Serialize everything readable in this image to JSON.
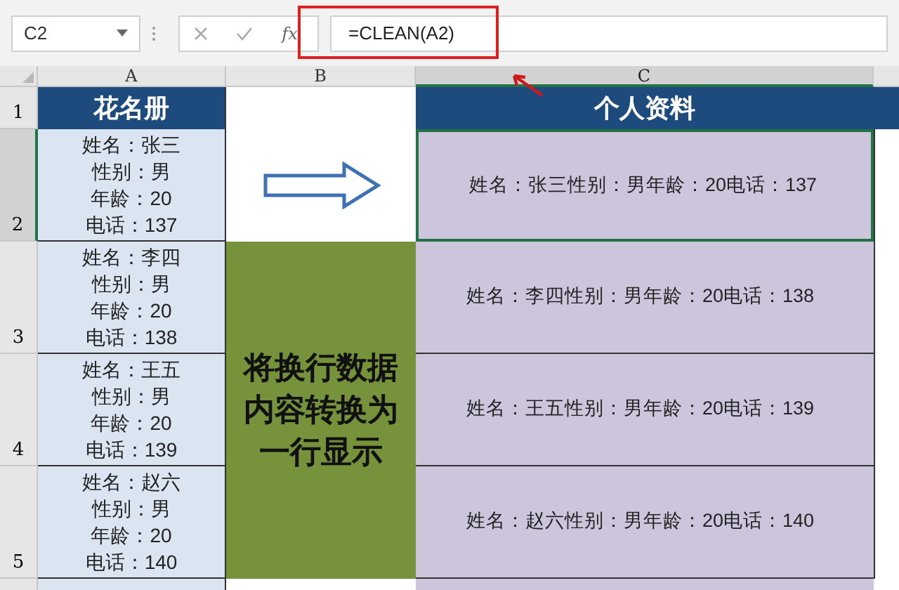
{
  "name_box": "C2",
  "function_label": "fx",
  "formula": "=CLEAN(A2)",
  "columns": [
    {
      "label": "A",
      "selected": false
    },
    {
      "label": "B",
      "selected": false
    },
    {
      "label": "C",
      "selected": true
    }
  ],
  "rows": [
    {
      "number": "1",
      "selected": false
    },
    {
      "number": "2",
      "selected": true
    },
    {
      "number": "3",
      "selected": false
    },
    {
      "number": "4",
      "selected": false
    },
    {
      "number": "5",
      "selected": false
    }
  ],
  "headers": {
    "source": "花名册",
    "result": "个人资料"
  },
  "note": [
    "将换行数据",
    "内容转换为",
    "一行显示"
  ],
  "records": [
    {
      "source": [
        "姓名：张三",
        "性别：男",
        "年龄：20",
        "电话：137"
      ],
      "result": "姓名：张三性别：男年龄：20电话：137",
      "selected": true
    },
    {
      "source": [
        "姓名：李四",
        "性别：男",
        "年龄：20",
        "电话：138"
      ],
      "result": "姓名：李四性别：男年龄：20电话：138",
      "selected": false
    },
    {
      "source": [
        "姓名：王五",
        "性别：男",
        "年龄：20",
        "电话：139"
      ],
      "result": "姓名：王五性别：男年龄：20电话：139",
      "selected": false
    },
    {
      "source": [
        "姓名：赵六",
        "性别：男",
        "年龄：20",
        "电话：140"
      ],
      "result": "姓名：赵六性别：男年龄：20电话：140",
      "selected": false
    }
  ]
}
